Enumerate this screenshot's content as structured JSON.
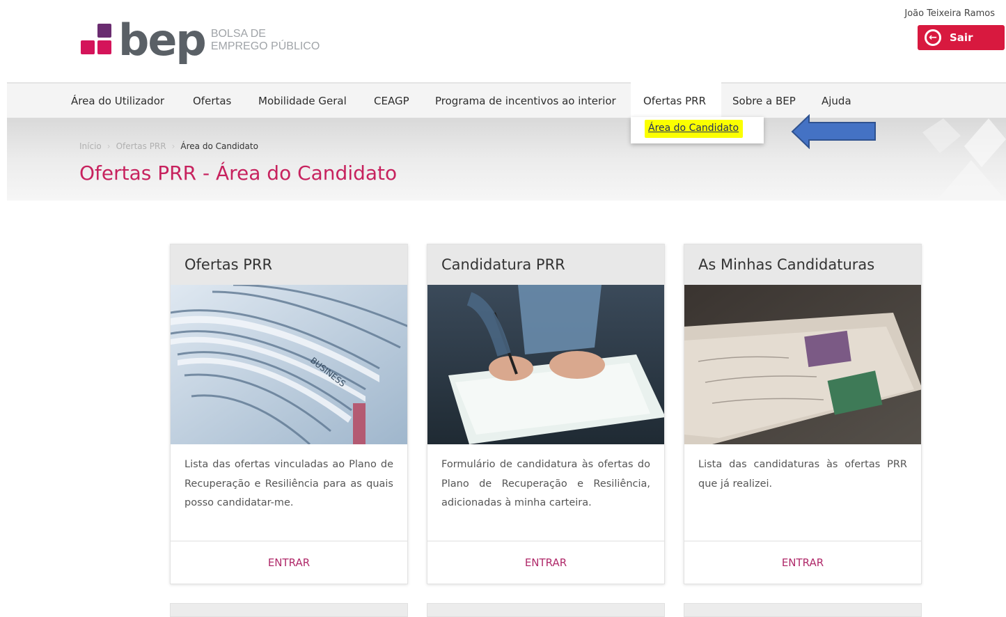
{
  "header": {
    "logo_word": "bep",
    "logo_sub_1": "BOLSA DE",
    "logo_sub_2": "EMPREGO PÚBLICO",
    "user_name": "João Teixeira Ramos",
    "logout_label": "Sair",
    "logout_icon": "logout-arrow-icon",
    "brand_colors": {
      "purple": "#6a2c70",
      "crimson": "#d4145a",
      "logout_bg": "#d8193f"
    }
  },
  "nav": {
    "items": [
      {
        "label": "Área do Utilizador"
      },
      {
        "label": "Ofertas"
      },
      {
        "label": "Mobilidade Geral"
      },
      {
        "label": "CEAGP"
      },
      {
        "label": "Programa de incentivos ao interior"
      },
      {
        "label": "Ofertas PRR"
      },
      {
        "label": "Sobre a BEP"
      },
      {
        "label": "Ajuda"
      }
    ],
    "active": "Ofertas PRR",
    "dropdown": {
      "label": "Área do Candidato",
      "highlight_color": "#fbff00"
    }
  },
  "annotation": {
    "arrow_color": "#4472c4",
    "icon": "left-arrow-icon"
  },
  "banner": {
    "breadcrumb": [
      "Início",
      "Ofertas PRR",
      "Área do Candidato"
    ],
    "title": "Ofertas PRR - Área do Candidato",
    "title_color": "#c7225e"
  },
  "cards": [
    {
      "title": "Ofertas PRR",
      "image": "newspapers-image",
      "description": "Lista das ofertas vinculadas ao Plano de Recuperação e Resiliência para as quais posso candidatar-me.",
      "action": "ENTRAR"
    },
    {
      "title": "Candidatura PRR",
      "image": "signing-document-image",
      "description": "Formulário de candidatura às ofertas do Plano de Recuperação e Resiliência, adicionadas à minha carteira.",
      "action": "ENTRAR"
    },
    {
      "title": "As Minhas Candidaturas",
      "image": "envelopes-stamps-image",
      "description": "Lista das candidaturas às ofertas PRR que já realizei.",
      "action": "ENTRAR"
    }
  ]
}
